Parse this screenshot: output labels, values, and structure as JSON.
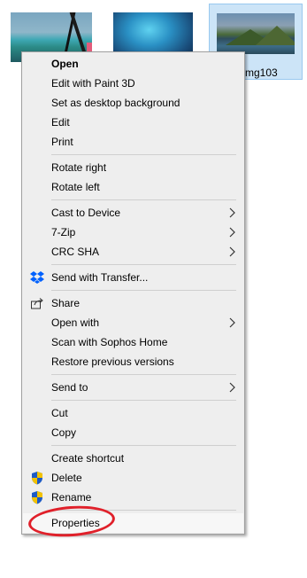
{
  "desktop": {
    "selected_file_label": "mg103"
  },
  "menu": {
    "items": [
      {
        "label": "Open"
      },
      {
        "label": "Edit with Paint 3D"
      },
      {
        "label": "Set as desktop background"
      },
      {
        "label": "Edit"
      },
      {
        "label": "Print"
      },
      {
        "label": "Rotate right"
      },
      {
        "label": "Rotate left"
      },
      {
        "label": "Cast to Device"
      },
      {
        "label": "7-Zip"
      },
      {
        "label": "CRC SHA"
      },
      {
        "label": "Send with Transfer..."
      },
      {
        "label": "Share"
      },
      {
        "label": "Open with"
      },
      {
        "label": "Scan with Sophos Home"
      },
      {
        "label": "Restore previous versions"
      },
      {
        "label": "Send to"
      },
      {
        "label": "Cut"
      },
      {
        "label": "Copy"
      },
      {
        "label": "Create shortcut"
      },
      {
        "label": "Delete"
      },
      {
        "label": "Rename"
      },
      {
        "label": "Properties"
      }
    ]
  },
  "colors": {
    "menu_bg": "#eeeeee",
    "annotation_circle": "#e0202a",
    "dropbox_blue": "#0061fe",
    "shield_blue": "#1e5bc6",
    "shield_yellow": "#f2c200"
  },
  "icons": {
    "transfer": "dropbox-icon",
    "share": "share-icon",
    "delete": "uac-shield-icon",
    "rename": "uac-shield-icon",
    "submenu": "chevron-right-icon"
  }
}
